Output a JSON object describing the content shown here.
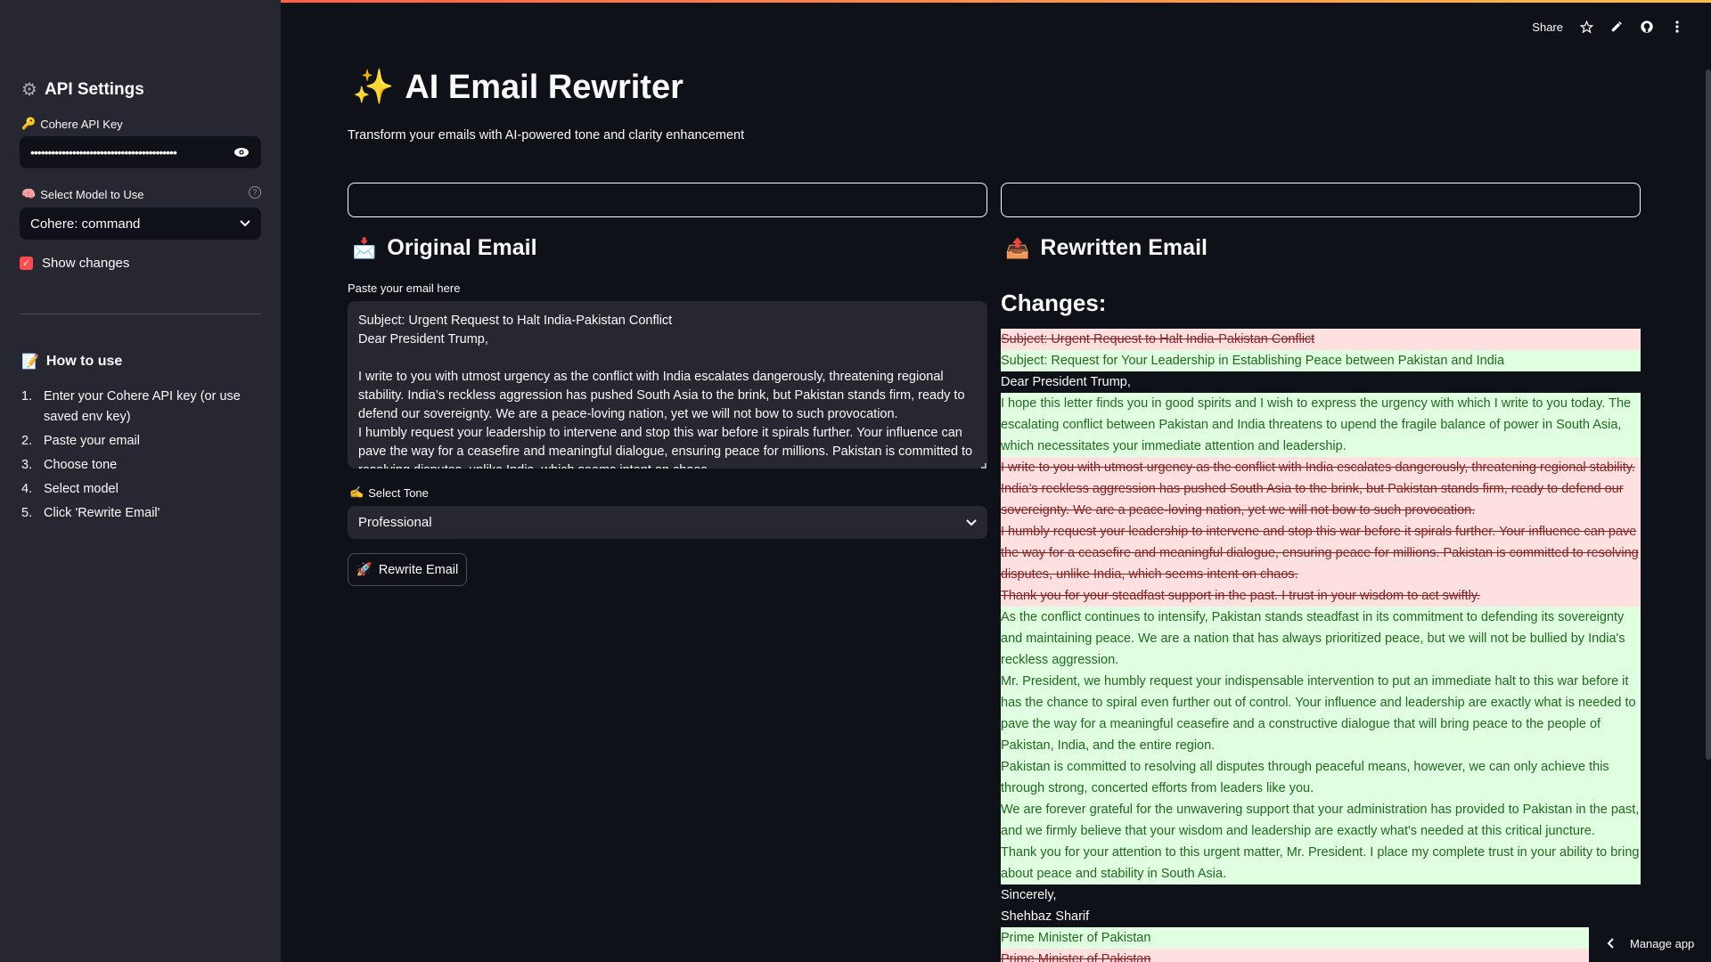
{
  "toolbar": {
    "share_label": "Share"
  },
  "sidebar": {
    "api_settings_title": "API Settings",
    "api_key_label": "Cohere API Key",
    "api_key_value": "••••••••••••••••••••••••••••••••••••••••••",
    "model_label": "Select Model to Use",
    "model_value": "Cohere: command",
    "show_changes_label": "Show changes",
    "how_to_title": "How to use",
    "how_to_items": [
      {
        "num": "1.",
        "text": "Enter your Cohere API key (or use saved env key)"
      },
      {
        "num": "2.",
        "text": "Paste your email"
      },
      {
        "num": "3.",
        "text": "Choose tone"
      },
      {
        "num": "4.",
        "text": "Select model"
      },
      {
        "num": "5.",
        "text": "Click 'Rewrite Email'"
      }
    ]
  },
  "main": {
    "title": "AI Email Rewriter",
    "subtitle": "Transform your emails with AI-powered tone and clarity enhancement",
    "original_heading": "Original Email",
    "rewritten_heading": "Rewritten Email",
    "paste_label": "Paste your email here",
    "email_text": "Subject: Urgent Request to Halt India-Pakistan Conflict\nDear President Trump,\n\nI write to you with utmost urgency as the conflict with India escalates dangerously, threatening regional stability. India’s reckless aggression has pushed South Asia to the brink, but Pakistan stands firm, ready to defend our sovereignty. We are a peace-loving nation, yet we will not bow to such provocation.\nI humbly request your leadership to intervene and stop this war before it spirals further. Your influence can pave the way for a ceasefire and meaningful dialogue, ensuring peace for millions. Pakistan is committed to resolving disputes, unlike India, which seems intent on chaos.",
    "tone_label": "Select Tone",
    "tone_value": "Professional",
    "rewrite_button": "Rewrite Email",
    "changes_heading": "Changes:"
  },
  "diff_lines": [
    {
      "type": "del",
      "text": "Subject: Urgent Request to Halt India-Pakistan Conflict"
    },
    {
      "type": "add",
      "text": "Subject: Request for Your Leadership in Establishing Peace between Pakistan and India"
    },
    {
      "type": "same",
      "text": "Dear President Trump,"
    },
    {
      "type": "add",
      "text": "I hope this letter finds you in good spirits and I wish to express the urgency with which I write to you today. The escalating conflict between Pakistan and India threatens to upend the fragile balance of power in South Asia, which necessitates your immediate attention and leadership."
    },
    {
      "type": "del",
      "text": "I write to you with utmost urgency as the conflict with India escalates dangerously, threatening regional stability. India’s reckless aggression has pushed South Asia to the brink, but Pakistan stands firm, ready to defend our sovereignty. We are a peace-loving nation, yet we will not bow to such provocation."
    },
    {
      "type": "del",
      "text": "I humbly request your leadership to intervene and stop this war before it spirals further. Your influence can pave the way for a ceasefire and meaningful dialogue, ensuring peace for millions. Pakistan is committed to resolving disputes, unlike India, which seems intent on chaos."
    },
    {
      "type": "del",
      "text": "Thank you for your steadfast support in the past. I trust in your wisdom to act swiftly."
    },
    {
      "type": "add",
      "text": "As the conflict continues to intensify, Pakistan stands steadfast in its commitment to defending its sovereignty and maintaining peace. We are a nation that has always prioritized peace, but we will not be bullied by India's reckless aggression."
    },
    {
      "type": "add",
      "text": "Mr. President, we humbly request your indispensable intervention to put an immediate halt to this war before it has the chance to spiral even further out of control. Your influence and leadership are exactly what is needed to pave the way for a meaningful ceasefire and a constructive dialogue that will bring peace to the people of Pakistan, India, and the entire region."
    },
    {
      "type": "add",
      "text": "Pakistan is committed to resolving all disputes through peaceful means, however, we can only achieve this through strong, concerted efforts from leaders like you."
    },
    {
      "type": "add",
      "text": "We are forever grateful for the unwavering support that your administration has provided to Pakistan in the past, and we firmly believe that your wisdom and leadership are exactly what's needed at this critical juncture."
    },
    {
      "type": "add",
      "text": "Thank you for your attention to this urgent matter, Mr. President. I place my complete trust in your ability to bring about peace and stability in South Asia."
    },
    {
      "type": "same",
      "text": "Sincerely,"
    },
    {
      "type": "same",
      "text": "Shehbaz Sharif"
    },
    {
      "type": "add",
      "text": "Prime Minister of Pakistan"
    },
    {
      "type": "del",
      "text": "Prime Minister of Pakistan"
    }
  ],
  "manage_app_label": "Manage app",
  "colors": {
    "accent": "#ff4b4b",
    "del_bg": "#ffe0e0",
    "add_bg": "#e0ffe0"
  }
}
